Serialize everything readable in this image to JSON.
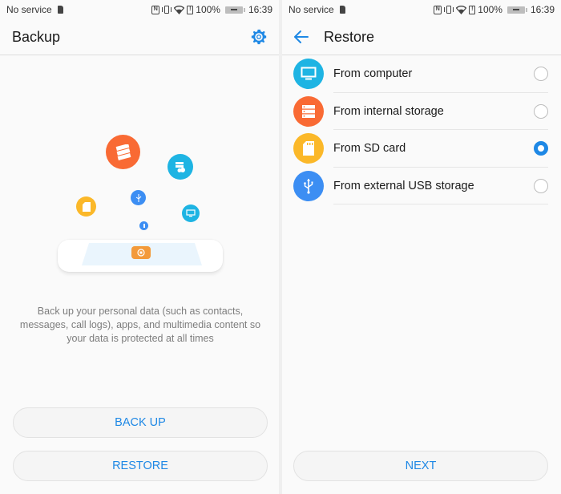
{
  "status_bar": {
    "carrier": "No service",
    "battery_percent": "100%",
    "time": "16:39",
    "icons": [
      "sim-icon",
      "nfc-icon",
      "vibrate-icon",
      "wifi-icon",
      "sim-status-icon",
      "battery-charging-icon"
    ]
  },
  "backup_screen": {
    "title": "Backup",
    "settings_icon": "gear-icon",
    "illustration_icons": [
      "internal-storage-icon",
      "cloud-storage-icon",
      "usb-icon",
      "sd-card-icon",
      "computer-icon",
      "usb-small-icon",
      "phone-icon",
      "backup-app-icon"
    ],
    "description": "Back up your personal data (such as contacts, messages, call logs), apps, and multimedia content so your data is protected at all times",
    "buttons": {
      "backup": "BACK UP",
      "restore": "RESTORE"
    }
  },
  "restore_screen": {
    "title": "Restore",
    "back_icon": "arrow-back-icon",
    "options": [
      {
        "label": "From computer",
        "icon": "computer-icon",
        "color": "#1eb4e3",
        "selected": false
      },
      {
        "label": "From internal storage",
        "icon": "internal-storage-icon",
        "color": "#f96a34",
        "selected": false
      },
      {
        "label": "From SD card",
        "icon": "sd-card-icon",
        "color": "#fbb829",
        "selected": true
      },
      {
        "label": "From external USB storage",
        "icon": "usb-icon",
        "color": "#3c8ef3",
        "selected": false
      }
    ],
    "next_button": "NEXT"
  },
  "colors": {
    "accent": "#1e88e5",
    "background": "#fafafa",
    "text_primary": "#1a1a1a",
    "text_secondary": "#7d7d7d"
  }
}
